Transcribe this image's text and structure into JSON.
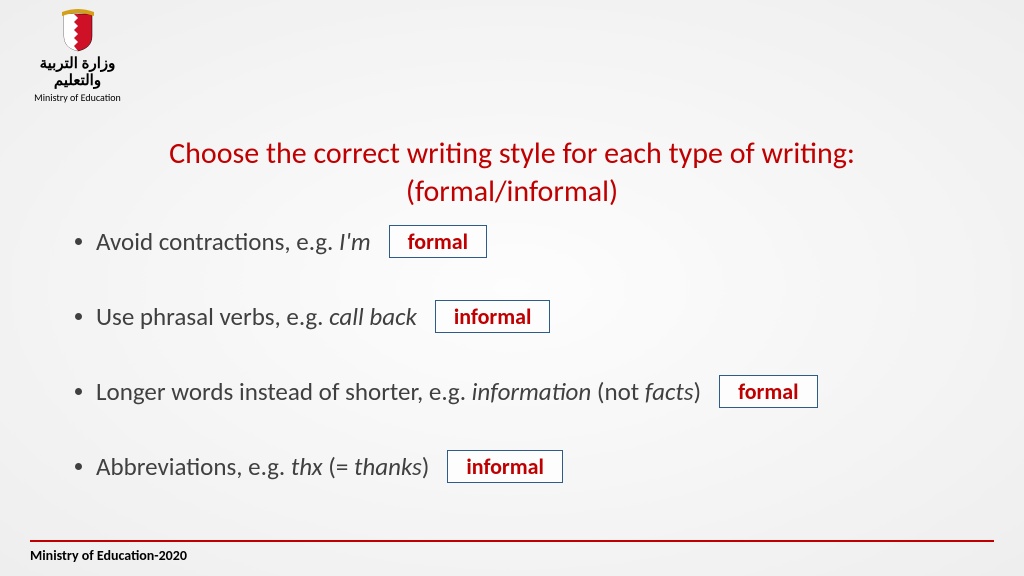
{
  "logo": {
    "arabic": "وزارة التربية والتعليم",
    "english": "Ministry of Education"
  },
  "title": {
    "line1": "Choose the correct writing style for each type of writing:",
    "line2": "(formal/informal)"
  },
  "bullets": [
    {
      "prefix": "Avoid contractions, e.g. ",
      "italic": "I'm",
      "suffix": "",
      "answer": "formal"
    },
    {
      "prefix": "Use phrasal verbs, e.g. ",
      "italic": "call back",
      "suffix": "",
      "answer": "informal"
    },
    {
      "prefix": "Longer words instead of shorter, e.g. ",
      "italic": "information",
      "suffix": " (not ",
      "italic2": "facts",
      "suffix2": ")",
      "answer": "formal"
    },
    {
      "prefix": "Abbreviations, e.g. ",
      "italic": "thx",
      "suffix": " (= ",
      "italic2": "thanks",
      "suffix2": ")",
      "answer": "informal"
    }
  ],
  "footer": "Ministry of Education-2020"
}
